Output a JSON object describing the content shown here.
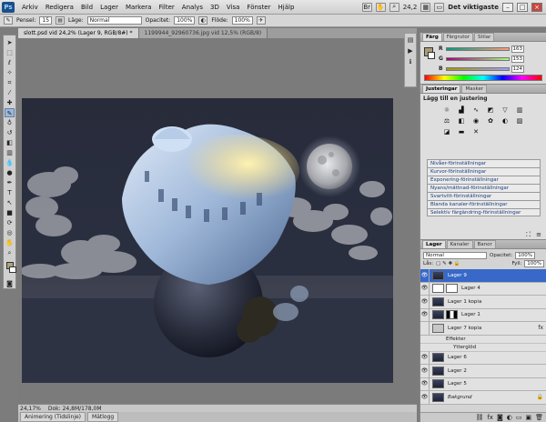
{
  "menubar": {
    "logo": "Ps",
    "items": [
      "Arkiv",
      "Redigera",
      "Bild",
      "Lager",
      "Markera",
      "Filter",
      "Analys",
      "3D",
      "Visa",
      "Fönster",
      "Hjälp"
    ],
    "zoom": "24,2",
    "workspace": "Det viktigaste"
  },
  "options": {
    "brush_label": "Pensel:",
    "brush_size": "15",
    "mode_label": "Läge:",
    "mode_value": "Normal",
    "opacity_label": "Opacitet:",
    "opacity_value": "100%",
    "flow_label": "Flöde:",
    "flow_value": "100%"
  },
  "tabs": [
    {
      "label": "slott.psd vid 24,2% (Lager 9, RGB/8#) *",
      "active": true
    },
    {
      "label": "1199944_92960736.jpg vid 12,5% (RGB/8)",
      "active": false
    }
  ],
  "status": {
    "zoom": "24,17%",
    "doc": "Dok: 24,8M/178,0M"
  },
  "bottom_tabs": [
    "Animering (Tidslinje)",
    "Mätlogg"
  ],
  "color_panel": {
    "tabs": [
      "Färg",
      "Färgrutor",
      "Stilar"
    ],
    "r": "163",
    "g": "153",
    "b": "124",
    "fg": "#a99c78"
  },
  "adjust_panel": {
    "tabs": [
      "Justeringar",
      "Masker"
    ],
    "title": "Lägg till en justering",
    "presets": [
      "Nivåer-förinställningar",
      "Kurvor-förinställningar",
      "Exponering-förinställningar",
      "Nyans/mättnad-förinställningar",
      "Svartvitt-förinställningar",
      "Blanda kanaler-förinställningar",
      "Selektiv färgändring-förinställningar"
    ]
  },
  "layers_panel": {
    "tabs": [
      "Lager",
      "Kanaler",
      "Banor"
    ],
    "blend": "Normal",
    "opacity_label": "Opacitet:",
    "opacity": "100%",
    "lock_label": "Lås:",
    "fill_label": "Fyll:",
    "fill": "100%",
    "layers": [
      {
        "name": "Lager 9",
        "selected": true,
        "thumb": "night"
      },
      {
        "name": "Lager 4",
        "selected": false,
        "thumb": "white",
        "mask": true
      },
      {
        "name": "Lager 1 kopia",
        "selected": false,
        "thumb": "night",
        "mask": false
      },
      {
        "name": "Lager 1",
        "selected": false,
        "thumb": "night",
        "mask": true
      },
      {
        "name": "Lager 7 kopia",
        "selected": false,
        "thumb": "light",
        "fx": "fx"
      },
      {
        "name": "Lager 6",
        "selected": false,
        "thumb": "night"
      },
      {
        "name": "Lager 2",
        "selected": false,
        "thumb": "night"
      },
      {
        "name": "Lager 5",
        "selected": false,
        "thumb": "night"
      },
      {
        "name": "Bakgrund",
        "selected": false,
        "thumb": "night",
        "italic": true
      }
    ],
    "effects_label": "Effekter",
    "effect_item": "Ytterglöd"
  }
}
